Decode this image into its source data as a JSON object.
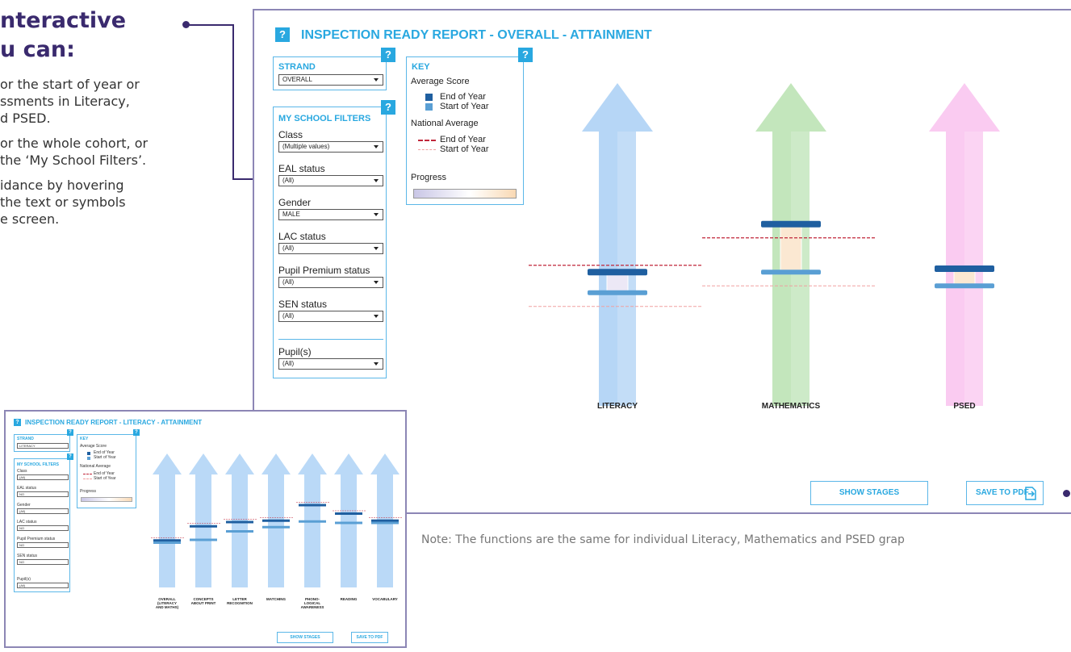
{
  "callout": {
    "title_line1": "nteractive",
    "title_line2": "u can:",
    "items": [
      "or the start of year or\nssments in Literacy,\nd PSED.",
      "or the whole cohort, or\nthe ‘My School Filters’.",
      "idance by hovering\nthe text or symbols\ne screen."
    ]
  },
  "report": {
    "title": "INSPECTION READY REPORT - OVERALL - ATTAINMENT",
    "help": "?",
    "strand": {
      "label": "STRAND",
      "value": "OVERALL"
    },
    "filters": {
      "title": "MY SCHOOL FILTERS",
      "items": [
        {
          "label": "Class",
          "value": "(Multiple values)"
        },
        {
          "label": "EAL status",
          "value": "(All)"
        },
        {
          "label": "Gender",
          "value": "MALE"
        },
        {
          "label": "LAC status",
          "value": "(All)"
        },
        {
          "label": "Pupil Premium status",
          "value": "(All)"
        },
        {
          "label": "SEN status",
          "value": "(All)"
        }
      ],
      "pupils": {
        "label": "Pupil(s)",
        "value": "(All)"
      }
    },
    "key": {
      "title": "KEY",
      "avg_heading": "Average Score",
      "end": "End of Year",
      "start": "Start of Year",
      "nat_heading": "National Average",
      "progress": "Progress",
      "colors": {
        "end": "#1f5fa0",
        "start": "#5a9fd4",
        "nat_end": "#c0263a",
        "nat_start": "#f0a0a0"
      }
    },
    "buttons": {
      "show_stages": "SHOW STAGES",
      "save_pdf": "SAVE TO PDF"
    },
    "note": "Note: The functions are the same for individual Literacy, Mathematics and PSED grap"
  },
  "chart_data": {
    "type": "bar",
    "categories": [
      "LITERACY",
      "MATHEMATICS",
      "PSED"
    ],
    "series": [
      {
        "name": "End of Year",
        "values": [
          3.9,
          5.3,
          4.0
        ]
      },
      {
        "name": "Start of Year",
        "values": [
          3.3,
          3.9,
          3.5
        ]
      },
      {
        "name": "National Average End of Year",
        "values": [
          4.1,
          4.9,
          null
        ]
      },
      {
        "name": "National Average Start of Year",
        "values": [
          2.9,
          3.5,
          null
        ]
      }
    ],
    "ylim": [
      0,
      8
    ],
    "colors": {
      "literacy": "#a9cff5",
      "mathematics": "#b8e2b0",
      "psed": "#f9c2ef"
    }
  },
  "thumbnail": {
    "title": "INSPECTION READY REPORT - LITERACY - ATTAINMENT",
    "strand_label": "STRAND",
    "strand_value": "LITERACY",
    "filters_title": "MY SCHOOL FILTERS",
    "filter_items": [
      {
        "label": "Class",
        "value": "(All)"
      },
      {
        "label": "EAL status",
        "value": "NO"
      },
      {
        "label": "Gender",
        "value": "(All)"
      },
      {
        "label": "LAC status",
        "value": "NO"
      },
      {
        "label": "Pupil Premium status",
        "value": "NO"
      },
      {
        "label": "SEN status",
        "value": "NO"
      },
      {
        "label": "Pupil(s)",
        "value": "(All)"
      }
    ],
    "key_title": "KEY",
    "categories": [
      "OVERALL\n(LITERACY\nAND MATHS)",
      "CONCEPTS\nABOUT PRINT",
      "LETTER\nRECOGNITION",
      "MATCHING",
      "PHONO-\nLOGICAL\nAWARENESS",
      "READING",
      "VOCABULARY"
    ],
    "end_values": [
      3.3,
      4.3,
      4.6,
      4.7,
      5.8,
      5.2,
      4.7
    ],
    "start_values": [
      3.2,
      3.4,
      4.0,
      4.3,
      4.7,
      4.6,
      4.6
    ],
    "show_stages": "SHOW STAGES",
    "save_pdf": "SAVE TO PDF"
  }
}
